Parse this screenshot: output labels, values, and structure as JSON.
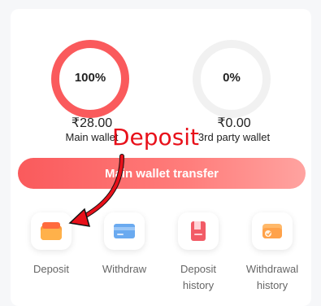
{
  "wallets": {
    "main": {
      "percent": "100%",
      "amount": "₹28.00",
      "label": "Main wallet"
    },
    "third": {
      "percent": "0%",
      "amount": "₹0.00",
      "label": "3rd party wallet"
    }
  },
  "transfer_button": {
    "label": "Main wallet transfer"
  },
  "actions": [
    {
      "label": "Deposit",
      "icon": "wallet-icon"
    },
    {
      "label": "Withdraw",
      "icon": "card-icon"
    },
    {
      "label": "Deposit history",
      "icon": "document-icon"
    },
    {
      "label": "Withdrawal history",
      "icon": "wallet-history-icon"
    }
  ],
  "annotation": {
    "text": "Deposit"
  },
  "colors": {
    "accent": "#fa5a5c",
    "annotation": "#e8101a"
  }
}
